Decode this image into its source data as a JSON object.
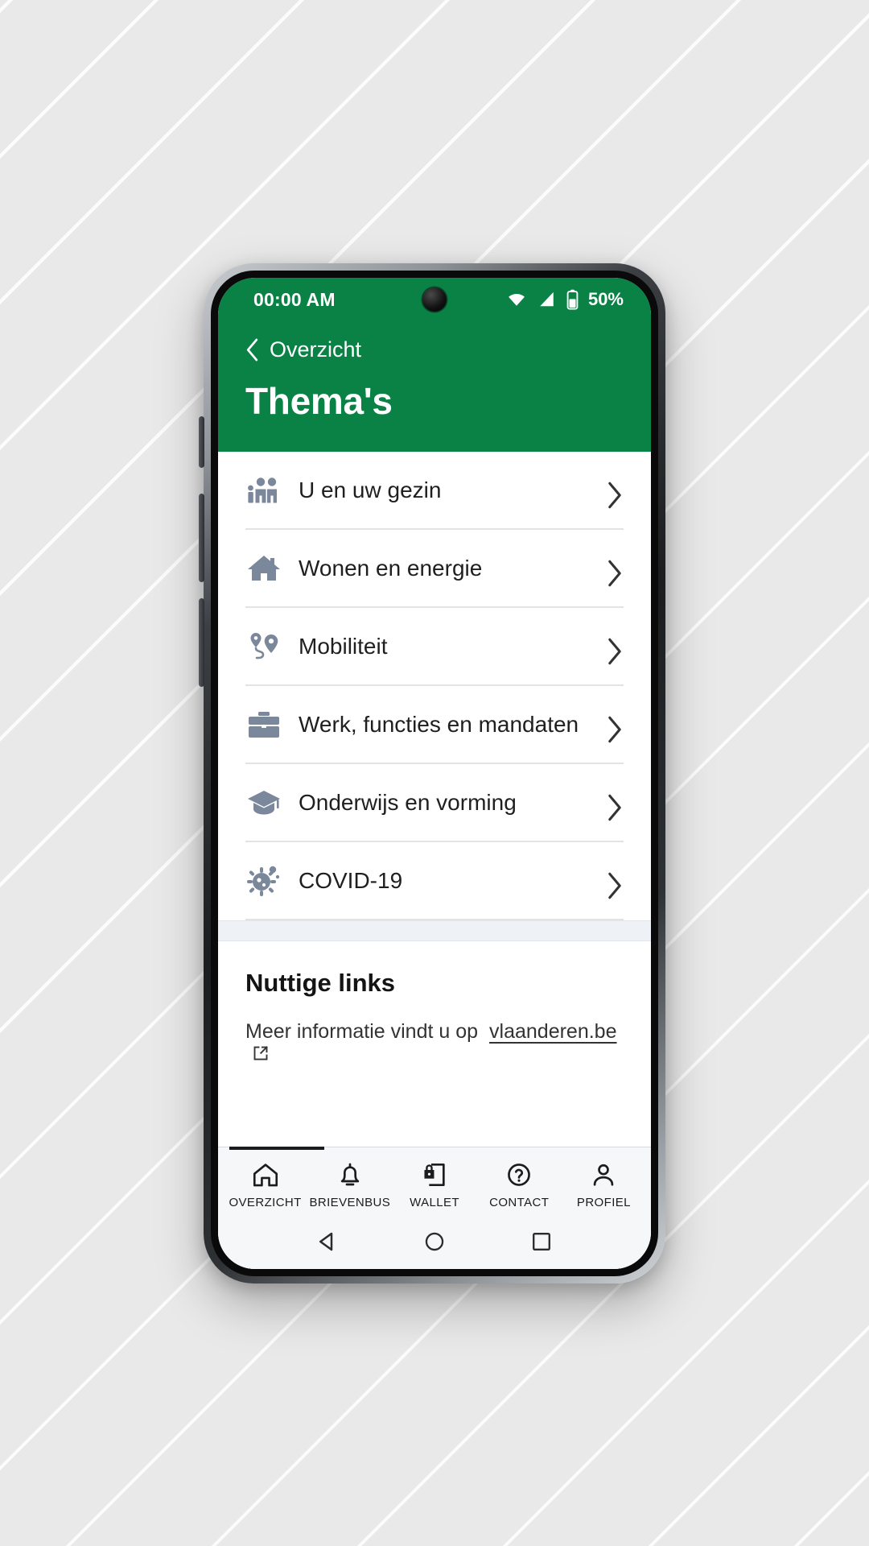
{
  "status_bar": {
    "time": "00:00 AM",
    "battery_percent": "50%",
    "icons": [
      "wifi-icon",
      "cellular-signal-icon",
      "battery-icon"
    ]
  },
  "header": {
    "back_label": "Overzicht",
    "back_icon": "chevron-left-icon",
    "title": "Thema's",
    "background_color": "#0a8246"
  },
  "themes": {
    "items": [
      {
        "label": "U en uw gezin",
        "icon": "family-icon"
      },
      {
        "label": "Wonen en energie",
        "icon": "house-icon"
      },
      {
        "label": "Mobiliteit",
        "icon": "map-pins-route-icon"
      },
      {
        "label": "Werk, functies en mandaten",
        "icon": "briefcase-icon"
      },
      {
        "label": "Onderwijs en vorming",
        "icon": "graduation-cap-icon"
      },
      {
        "label": "COVID-19",
        "icon": "virus-icon"
      }
    ],
    "chevron_icon": "chevron-right-icon",
    "icon_color": "#7b879b"
  },
  "useful_links": {
    "title": "Nuttige links",
    "text_prefix": "Meer informatie vindt u op",
    "link_label": "vlaanderen.be",
    "link_icon": "external-link-icon"
  },
  "tab_bar": {
    "active_index": 0,
    "tabs": [
      {
        "label": "OVERZICHT",
        "icon": "home-icon"
      },
      {
        "label": "BRIEVENBUS",
        "icon": "bell-icon"
      },
      {
        "label": "WALLET",
        "icon": "document-lock-icon"
      },
      {
        "label": "CONTACT",
        "icon": "question-circle-icon"
      },
      {
        "label": "PROFIEL",
        "icon": "person-icon"
      }
    ]
  },
  "android_nav": {
    "buttons": [
      {
        "name": "back-nav-button",
        "icon": "triangle-back-icon"
      },
      {
        "name": "home-nav-button",
        "icon": "circle-home-icon"
      },
      {
        "name": "recents-nav-button",
        "icon": "square-recents-icon"
      }
    ]
  }
}
